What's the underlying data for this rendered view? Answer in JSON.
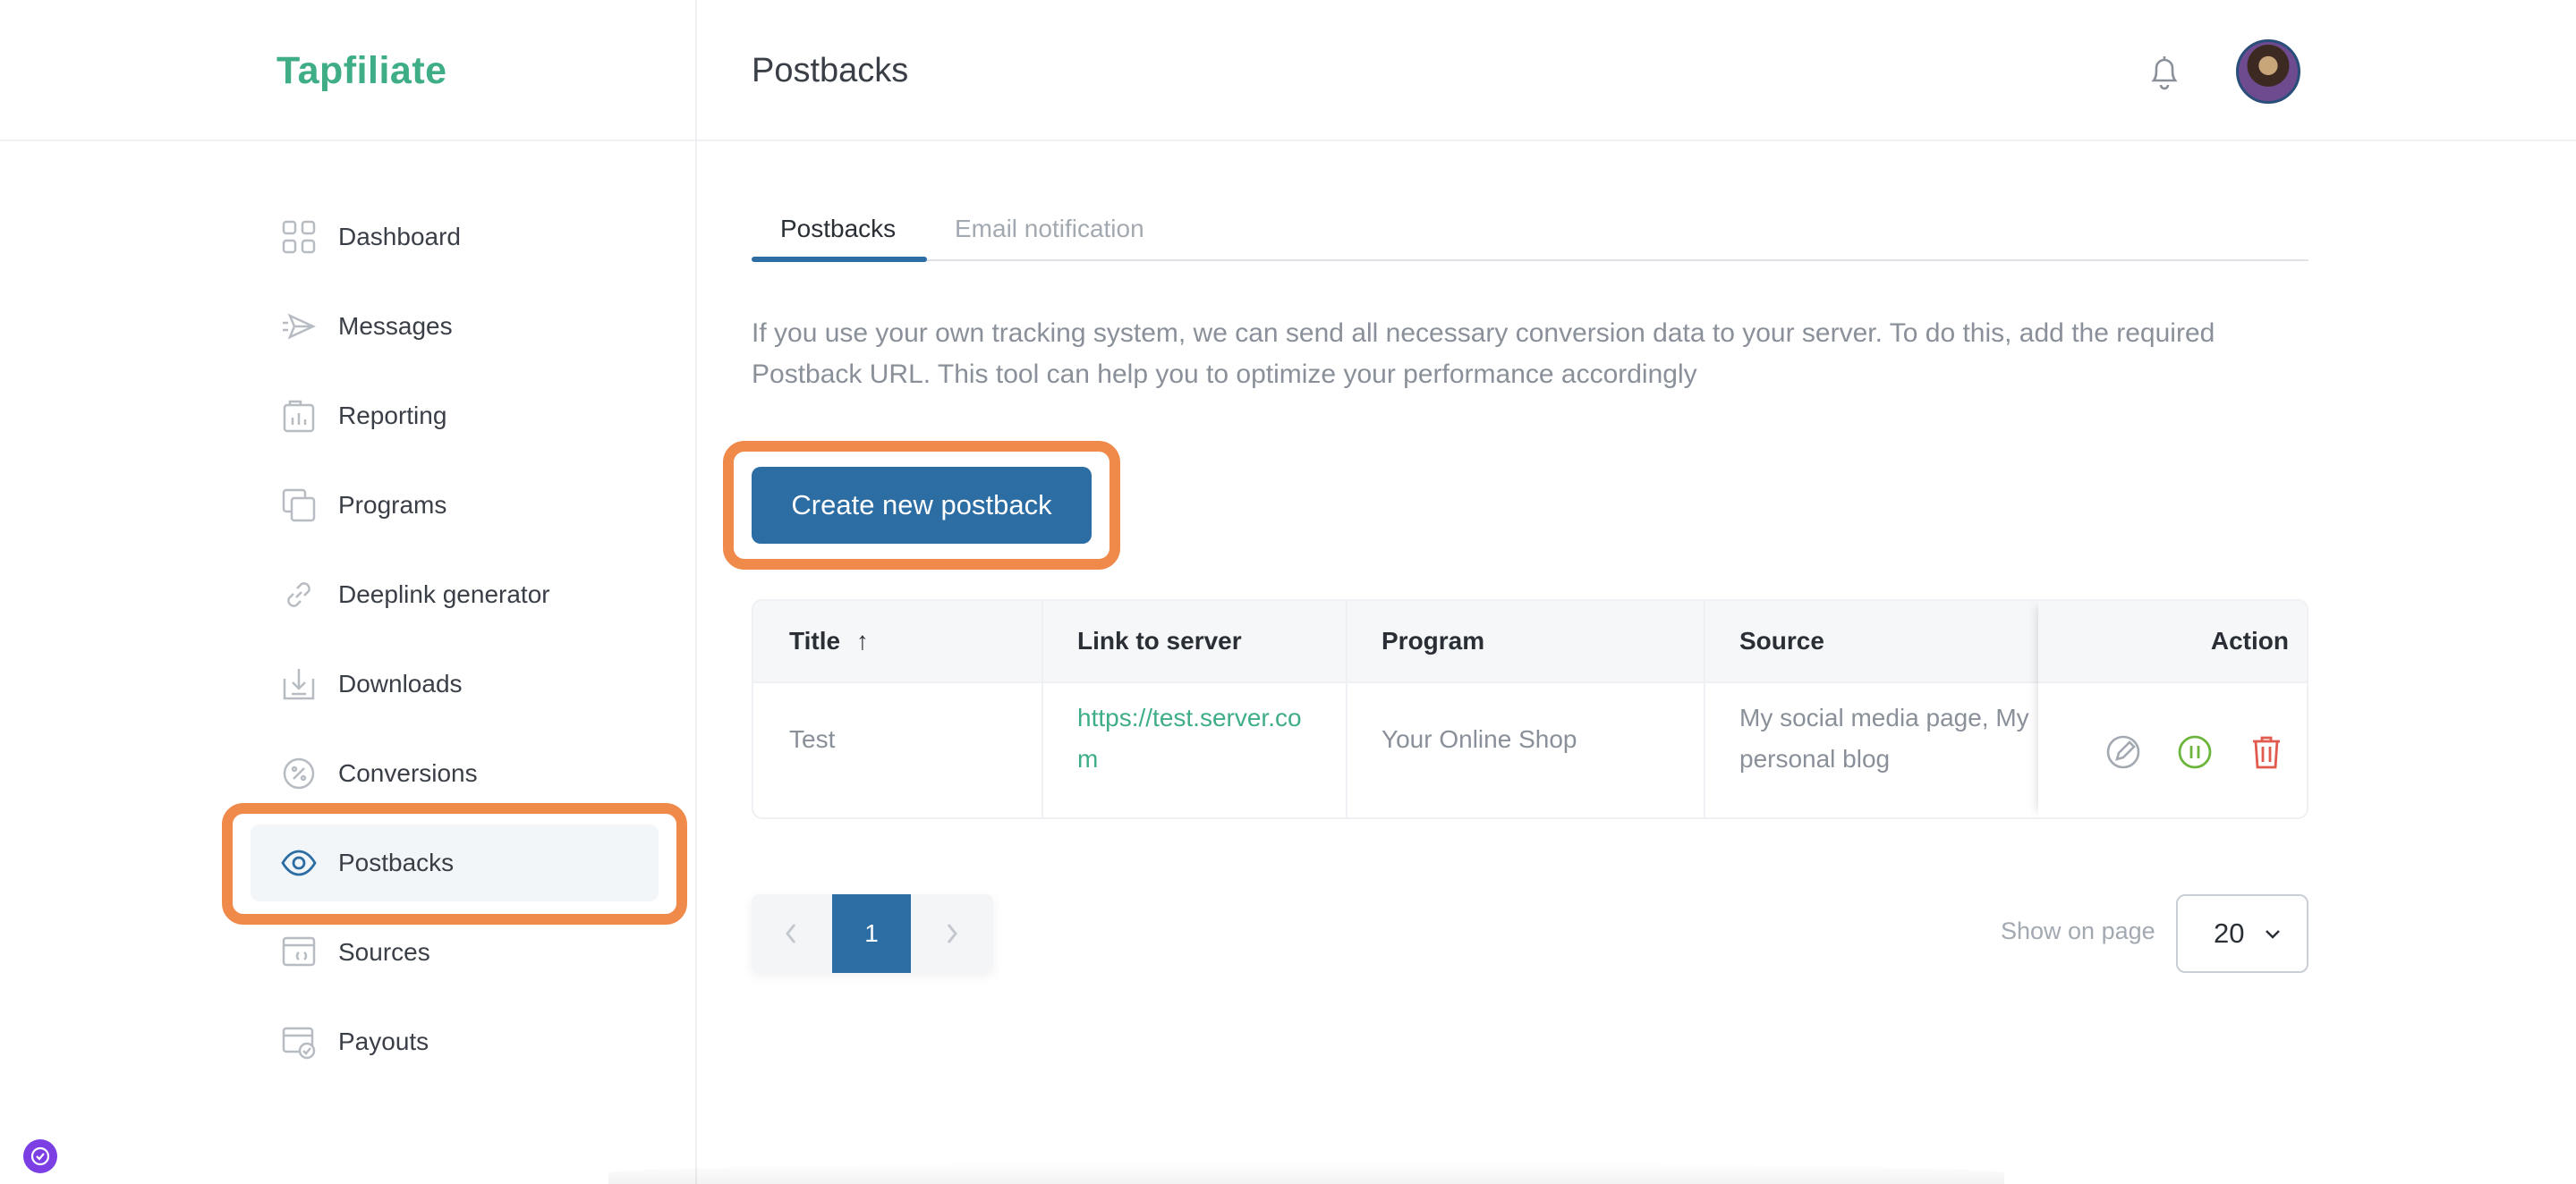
{
  "app": {
    "logo": "Tapfiliate"
  },
  "header": {
    "title": "Postbacks"
  },
  "sidebar": {
    "items": [
      {
        "label": "Dashboard",
        "icon": "dashboard-icon"
      },
      {
        "label": "Messages",
        "icon": "send-icon"
      },
      {
        "label": "Reporting",
        "icon": "report-icon"
      },
      {
        "label": "Programs",
        "icon": "copy-icon"
      },
      {
        "label": "Deeplink generator",
        "icon": "link-icon"
      },
      {
        "label": "Downloads",
        "icon": "download-icon"
      },
      {
        "label": "Conversions",
        "icon": "percent-icon"
      },
      {
        "label": "Postbacks",
        "icon": "eye-icon",
        "active": true
      },
      {
        "label": "Sources",
        "icon": "source-icon"
      },
      {
        "label": "Payouts",
        "icon": "payout-icon"
      }
    ]
  },
  "tabs": [
    {
      "label": "Postbacks",
      "active": true
    },
    {
      "label": "Email notification",
      "active": false
    }
  ],
  "description": "If you use your own tracking system, we can send all necessary conversion data to your server. To do this, add the required Postback URL. This tool can help you to optimize your performance accordingly",
  "create_button": {
    "label": "Create new postback"
  },
  "table": {
    "headers": {
      "title": "Title",
      "sort_indicator": "↑",
      "link": "Link to server",
      "program": "Program",
      "source": "Source",
      "action": "Action"
    },
    "rows": [
      {
        "title": "Test",
        "link_line1": "https://test.server.co",
        "link_line2": "m",
        "program": "Your Online Shop",
        "source_line1": "My social media page, My",
        "source_line2": "personal blog"
      }
    ]
  },
  "pagination": {
    "current_page": "1",
    "show_label": "Show on page",
    "per_page": "20"
  },
  "colors": {
    "brand": "#3fae86",
    "primary": "#2c6da3",
    "highlight": "#f08a4b",
    "link": "#3fae86",
    "pause": "#6cb53c",
    "delete": "#e05a4e"
  }
}
